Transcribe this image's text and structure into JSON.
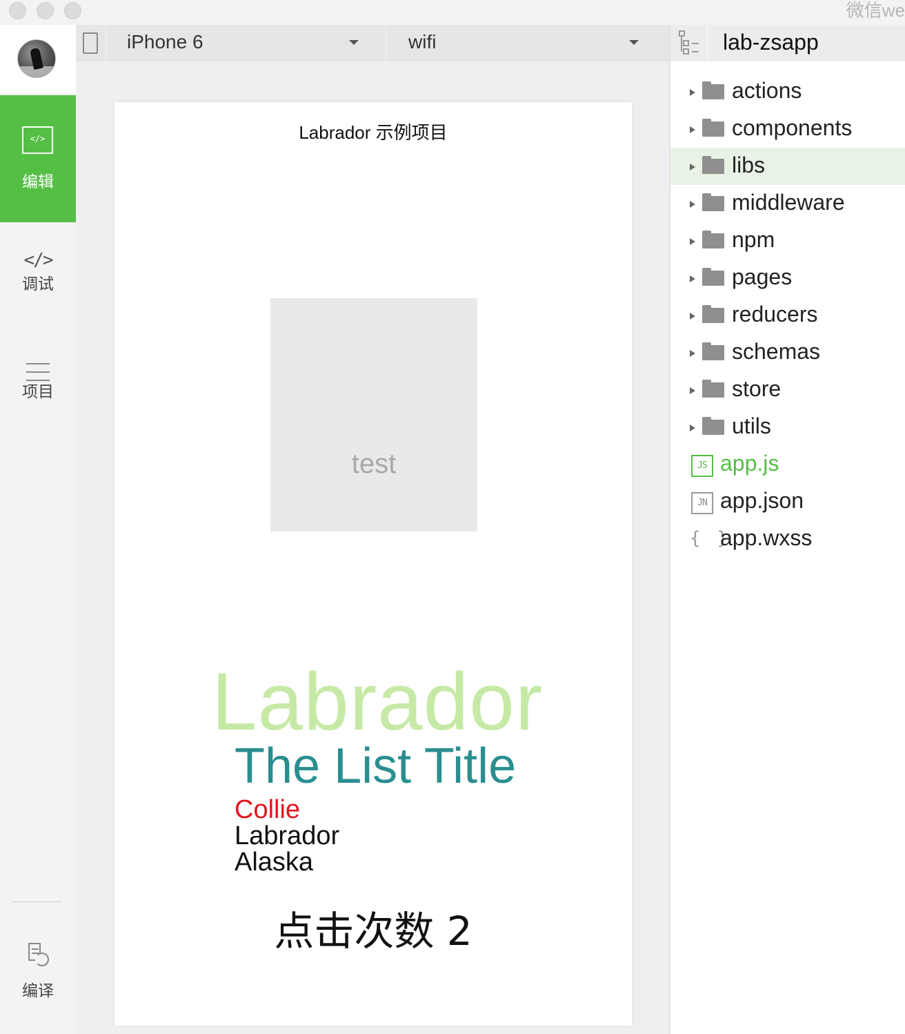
{
  "window": {
    "title": "微信we"
  },
  "sidebar": {
    "items": [
      {
        "label": "编辑",
        "icon": "code-editor-icon",
        "active": true
      },
      {
        "label": "调试",
        "icon": "code-brackets-icon",
        "glyph": "</>"
      },
      {
        "label": "项目",
        "icon": "list-icon"
      },
      {
        "label": "编译",
        "icon": "compile-icon"
      }
    ],
    "editor_glyph": "</>"
  },
  "toolbar": {
    "device": "iPhone 6",
    "network": "wifi"
  },
  "simulator": {
    "page_title": "Labrador 示例项目",
    "test_box_text": "test",
    "brand_text": "Labrador",
    "list_title": "The List Title",
    "list_items": [
      "Collie",
      "Labrador",
      "Alaska"
    ],
    "highlighted_item_index": 0,
    "click_count_text": "点击次数 2"
  },
  "file_tree": {
    "project_name": "lab-zsapp",
    "folders": [
      {
        "name": "actions"
      },
      {
        "name": "components"
      },
      {
        "name": "libs",
        "selected": true
      },
      {
        "name": "middleware"
      },
      {
        "name": "npm"
      },
      {
        "name": "pages"
      },
      {
        "name": "reducers"
      },
      {
        "name": "schemas"
      },
      {
        "name": "store"
      },
      {
        "name": "utils"
      }
    ],
    "files": [
      {
        "name": "app.js",
        "badge": "JS",
        "active": true
      },
      {
        "name": "app.json",
        "badge": "JN"
      },
      {
        "name": "app.wxss",
        "badge": "{ }"
      }
    ]
  },
  "colors": {
    "accent_green": "#55bf45",
    "brand_light_green": "#c6eaa6",
    "list_title_teal": "#2a8e90",
    "highlight_red": "#e3141e"
  }
}
